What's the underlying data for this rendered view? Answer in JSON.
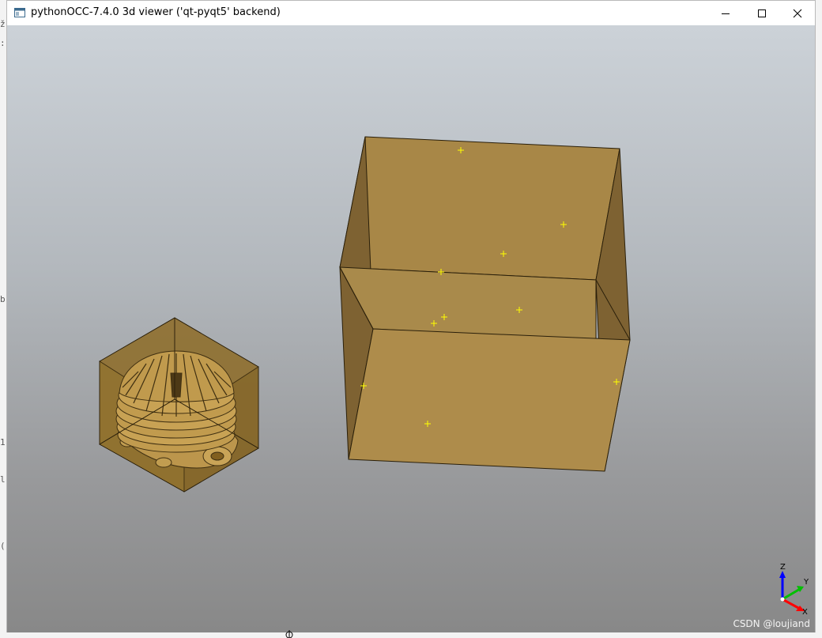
{
  "window": {
    "title": "pythonOCC-7.4.0 3d viewer ('qt-pyqt5' backend)"
  },
  "icons": {
    "app": "app-window-icon",
    "minimize": "minimize-icon",
    "maximize": "maximize-icon",
    "close": "close-icon"
  },
  "axes": {
    "z_label": "Z",
    "y_label": "Y",
    "x_label": "X",
    "z_color": "#0000ff",
    "y_color": "#00c000",
    "x_color": "#ff0000"
  },
  "colors": {
    "solid": "#b08c4a",
    "edge": "#2a1f0a",
    "vertex_marker": "#ffff00"
  },
  "background_fragments": [
    "ž",
    ":",
    "b",
    "1",
    "l",
    "("
  ],
  "watermark": "CSDN @loujiand"
}
